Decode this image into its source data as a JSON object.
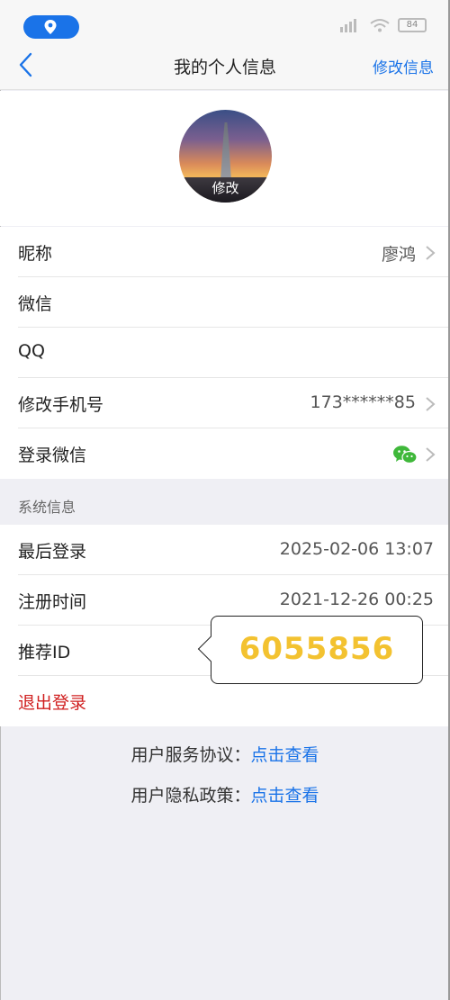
{
  "status_bar": {
    "battery": "84"
  },
  "navbar": {
    "title": "我的个人信息",
    "action": "修改信息"
  },
  "avatar": {
    "label": "修改"
  },
  "profile_rows": [
    {
      "label": "昵称",
      "value": "廖鸿"
    },
    {
      "label": "微信",
      "value": ""
    },
    {
      "label": "QQ",
      "value": ""
    },
    {
      "label": "修改手机号",
      "value": "173******85"
    },
    {
      "label": "登录微信",
      "value": ""
    }
  ],
  "system_section": {
    "header": "系统信息"
  },
  "system_rows": [
    {
      "label": "最后登录",
      "value": "2025-02-06 13:07"
    },
    {
      "label": "注册时间",
      "value": "2021-12-26 00:25"
    },
    {
      "label": "推荐ID",
      "value": ""
    }
  ],
  "logout": {
    "label": "退出登录"
  },
  "referral_popup": {
    "value": "6055856"
  },
  "footer": {
    "service_label": "用户服务协议：",
    "service_link": "点击查看",
    "privacy_label": "用户隐私政策：",
    "privacy_link": "点击查看"
  },
  "colors": {
    "accent": "#1a73e8",
    "logout": "#d02020",
    "id_highlight": "#f3c230",
    "wechat": "#3fb83a"
  }
}
